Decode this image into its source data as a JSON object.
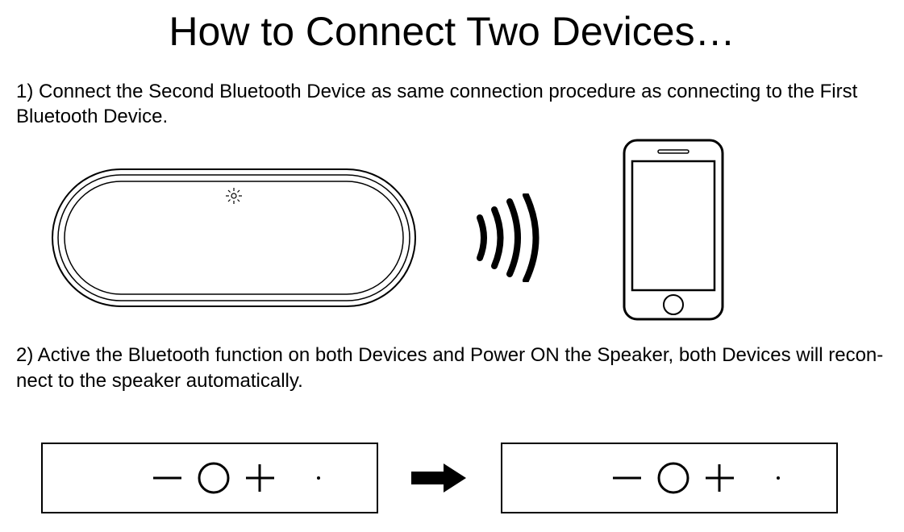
{
  "title": "How to Connect Two Devices…",
  "step1": "1) Connect the Second Bluetooth Device as same connection procedure as connecting to the First Bluetooth Device.",
  "step2": "2) Active the Bluetooth function on both Devices and Power ON the Speaker, both Devices will recon-nect to the speaker automatically."
}
